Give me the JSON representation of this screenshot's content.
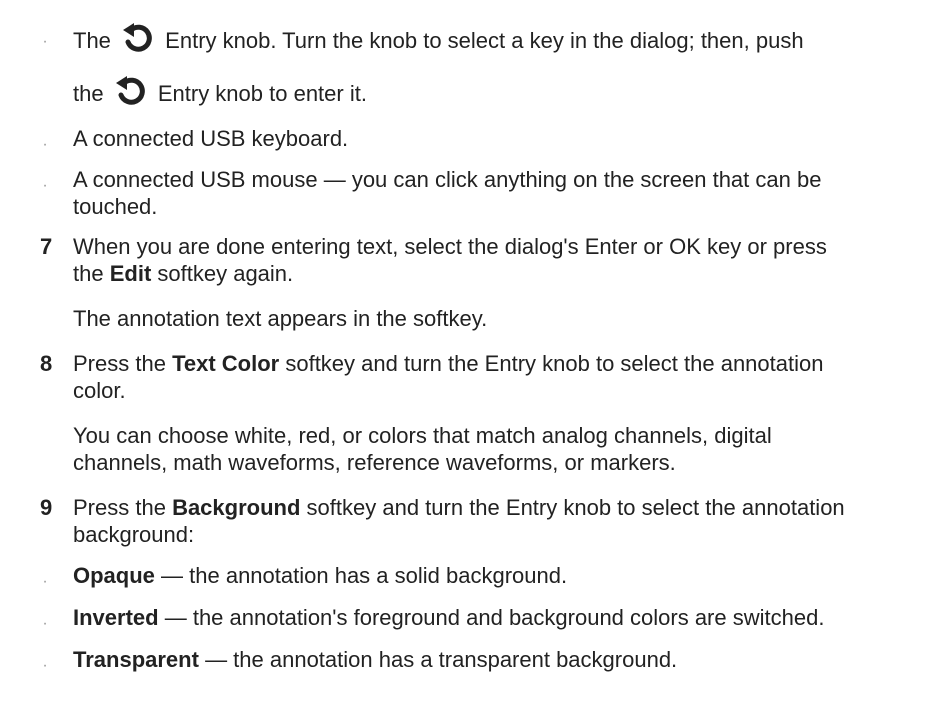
{
  "bullets_top": [
    {
      "pre": "The",
      "post": "Entry knob. Turn the knob to select a key in the dialog; then, push"
    },
    {
      "pre": "the",
      "post": "Entry knob to enter it."
    },
    {
      "text": "A connected USB keyboard."
    },
    {
      "line1": "A connected USB mouse — you can click anything on the screen that can be",
      "line2": "touched."
    }
  ],
  "steps": [
    {
      "num": "7",
      "line1": "When you are done entering text, select the dialog's Enter or OK key or press",
      "line2_pre": "the",
      "line2_bold": "Edit",
      "line2_post": "softkey again.",
      "note": "The annotation text appears in the softkey."
    },
    {
      "num": "8",
      "line1_pre": "Press the",
      "line1_bold": "Text Color",
      "line1_post": "softkey and turn the Entry knob to select the annotation",
      "line2": "color.",
      "note1": "You can choose white, red, or colors that match analog channels, digital",
      "note2": "channels, math waveforms, reference waveforms, or markers."
    },
    {
      "num": "9",
      "line1_pre": "Press the",
      "line1_bold": "Background",
      "line1_post": "softkey and turn the Entry knob to select the annotation",
      "line2": "background:",
      "options": [
        {
          "bold": "Opaque",
          "desc": "— the annotation has a solid background."
        },
        {
          "bold": "Inverted",
          "desc": "— the annotation's foreground and background colors are switched."
        },
        {
          "bold": "Transparent",
          "desc": "— the annotation has a transparent background."
        }
      ]
    }
  ],
  "bullet_char": "·",
  "icon": "entry-knob-icon"
}
